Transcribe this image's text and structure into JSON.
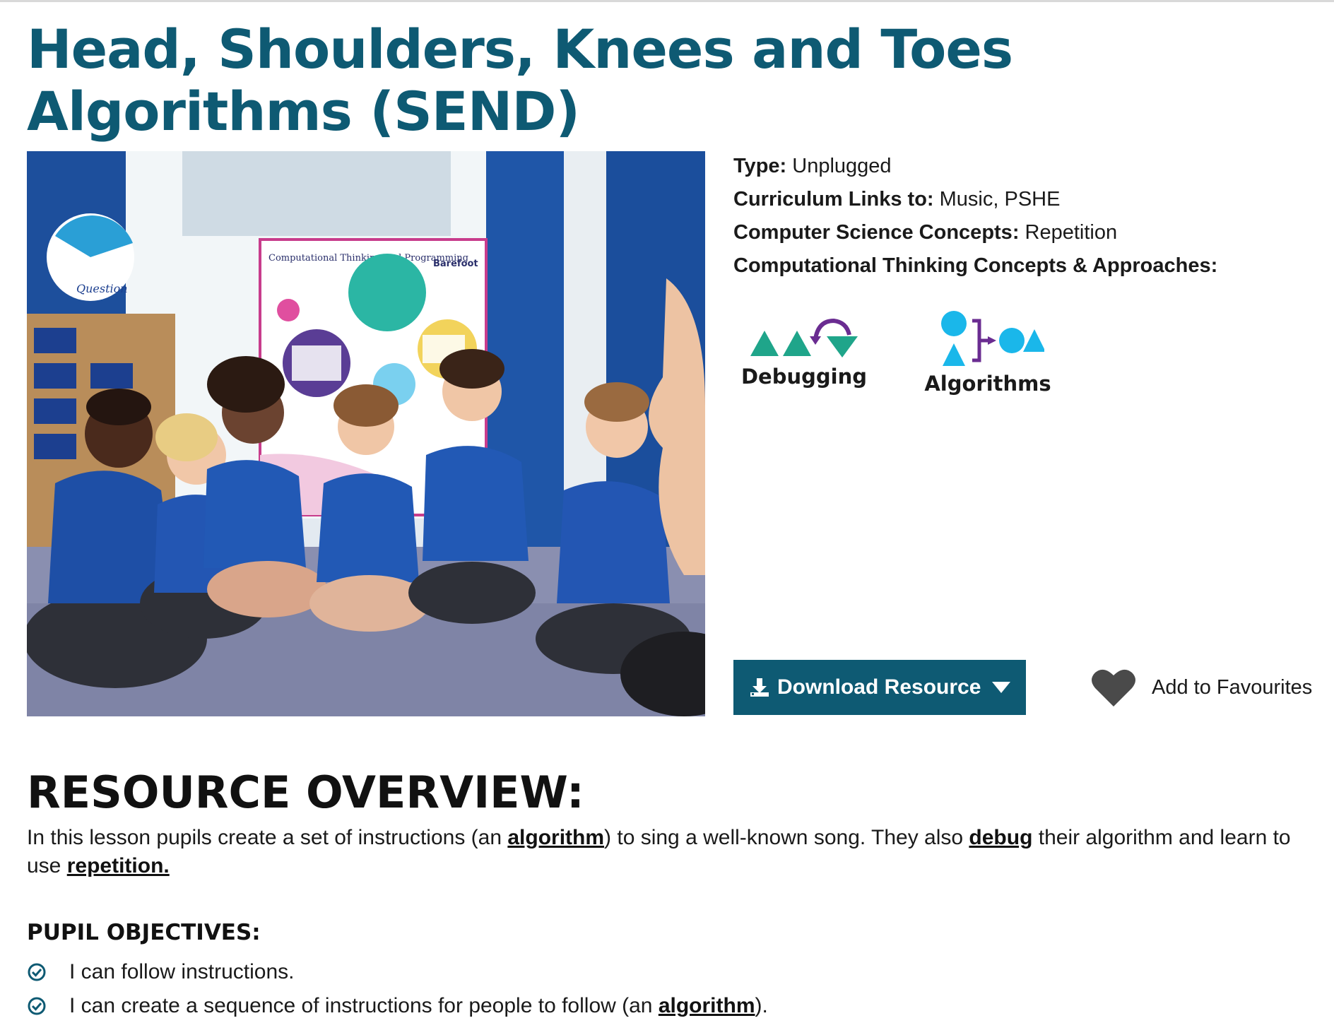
{
  "page": {
    "title": "Head, Shoulders, Knees and Toes Algorithms (SEND)"
  },
  "hero_image": {
    "poster_title": "Computational Thinking and Programming",
    "poster_brand": "Barefoot",
    "ball_text": "Question"
  },
  "meta": {
    "type_label": "Type:",
    "type_value": "Unplugged",
    "curriculum_label": "Curriculum Links to:",
    "curriculum_value": "Music, PSHE",
    "cs_label": "Computer Science Concepts:",
    "cs_value": "Repetition",
    "ct_label": "Computational Thinking Concepts & Approaches:"
  },
  "concepts": [
    {
      "label": "Debugging",
      "icon": "debugging-icon"
    },
    {
      "label": "Algorithms",
      "icon": "algorithms-icon"
    }
  ],
  "actions": {
    "download_label": "Download Resource",
    "favourite_label": "Add to Favourites"
  },
  "overview": {
    "heading": "RESOURCE OVERVIEW:",
    "text_1": "In this lesson pupils create a set of instructions (an ",
    "link_1": "algorithm",
    "text_2": ") to sing a well-known song. They also ",
    "link_2": "debug",
    "text_3": " their algorithm and learn to use ",
    "link_3": "repetition."
  },
  "objectives": {
    "heading": "PUPIL OBJECTIVES:",
    "items": [
      {
        "text": "I can follow instructions."
      },
      {
        "text": "I can create a sequence of instructions for people to follow (an ",
        "link": "algorithm",
        "after": ")."
      }
    ]
  },
  "colors": {
    "brand_teal": "#0e5a73",
    "icon_green": "#1fa58a",
    "icon_cyan": "#1ab7ea",
    "icon_purple": "#6a2c91",
    "heart_grey": "#4a4a4a"
  }
}
